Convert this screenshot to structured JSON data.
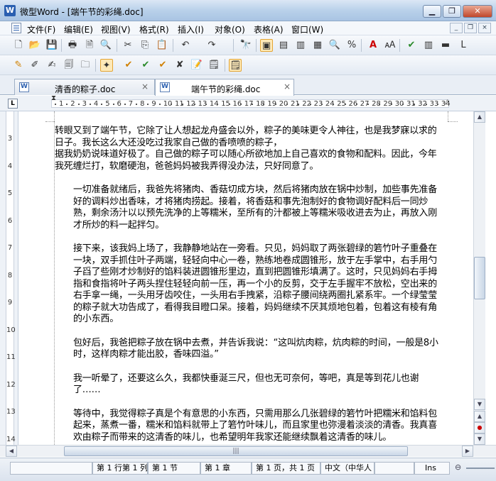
{
  "window": {
    "title": "微型Word - [端午节的彩绳.doc]",
    "app_icon": "W"
  },
  "window_controls": {
    "minimize": "▁",
    "restore": "❐",
    "close": "✕"
  },
  "menubar": {
    "items": [
      "文件(F)",
      "编辑(E)",
      "视图(V)",
      "格式(R)",
      "插入(I)",
      "对象(O)",
      "表格(A)",
      "窗口(W)"
    ],
    "mdi": {
      "minimize": "_",
      "restore": "❐",
      "close": "×"
    }
  },
  "toolbar1": {
    "icons": [
      "new-doc",
      "open-folder",
      "save",
      "print",
      "pdf",
      "print-preview",
      "cut",
      "copy",
      "paste",
      "undo",
      "redo",
      "find",
      "page-layout",
      "web-layout",
      "outline",
      "normal-view",
      "zoom",
      "find-replace",
      "font",
      "text-format",
      "spell-check",
      "columns",
      "format-painter",
      "justify"
    ],
    "glyphs": [
      "🗋",
      "📂",
      "💾",
      "🖶",
      "🗎",
      "🔍",
      "✂",
      "⎘",
      "📋",
      "↶",
      "↷",
      "🔭",
      "▣",
      "▤",
      "▥",
      "▦",
      "🔍",
      "%",
      "A",
      "🗚",
      "✔",
      "▥",
      "▬",
      "L"
    ]
  },
  "toolbar2": {
    "icons": [
      "track-changes",
      "edit-comment",
      "insert-comment",
      "delete-comment",
      "review-pane",
      "show-markup",
      "accept-change",
      "reject-change",
      "next-change",
      "prev-change",
      "sign-document",
      "final-document"
    ],
    "glyphs": [
      "✎",
      "✐",
      "✍",
      "🗐",
      "🗀",
      "✦",
      "✔",
      "✔",
      "✔",
      "✘",
      "📝",
      "🗒"
    ]
  },
  "tabs": [
    {
      "label": "清香的粽子.doc",
      "close": "×",
      "active": false
    },
    {
      "label": "端午节的彩绳.doc",
      "close": "×",
      "active": true
    }
  ],
  "ruler": {
    "corner": "L",
    "numbers": [
      "1",
      "2",
      "3",
      "4",
      "5",
      "6",
      "7",
      "8",
      "9",
      "10",
      "11",
      "12",
      "13",
      "14",
      "15",
      "16",
      "17",
      "18",
      "19",
      "20",
      "21",
      "22",
      "23",
      "24",
      "25",
      "26",
      "27",
      "28",
      "29",
      "30",
      "31",
      "32",
      "33",
      "34"
    ]
  },
  "vruler": {
    "numbers": [
      "3",
      "4",
      "5",
      "6",
      "7",
      "8",
      "9",
      "10",
      "11",
      "12",
      "13",
      "14"
    ]
  },
  "document": {
    "paragraphs": [
      {
        "indent": false,
        "text": "转眼又到了端午节，它除了让人想起龙舟盛会以外，粽子的美味更令人神往，也是我梦寐以求的日子。我长这么大还没吃过我家自己做的香喷喷的粽子，"
      },
      {
        "indent": false,
        "text": "据我奶奶说味道好极了。自己做的粽子可以随心所欲地加上自己喜欢的食物和配料。因此，今年我死缠烂打，软磨硬泡，爸爸妈妈被我弄得没办法，只好同意了。"
      },
      {
        "indent": true,
        "text": "一切准备就绪后，我爸先将猪肉、香菇切成方块，然后将猪肉放在锅中炒制，加些事先准备好的调料炒出香味，才将猪肉捞起。接着，将香菇和事先泡制好的食物调好配料后一同炒熟，剩余汤汁以以预先洗净的上等糯米，至所有的汁都被上等糯米吸收进去为止，再放入刚才所炒的料一起拌匀。"
      },
      {
        "indent": true,
        "text": "接下来，该我妈上场了，我静静地站在一旁看。只见，妈妈取了两张碧绿的箬竹叶子重叠在一块，双手抓住叶子两端，轻轻向中心一卷，熟练地卷成圆锥形，放于左手掌中，右手用勺子舀了些刚才炒制好的馅料装进圆锥形里边，直到把圆锥形填满了。这时，只见妈妈右手拇指和食指将叶子两头捏住轻轻向前一压，再一个小的反剪，交于左手握牢不放松，空出来的右手拿一绳，一头用牙齿咬住，一头用右手拽紧，沿粽子腰间绕两圈扎紧系牢。一个绿莹莹的粽子就大功告成了，看得我目瞪口呆。接着，妈妈继续不厌其烦地包着，包着这有棱有角的小东西。"
      },
      {
        "indent": true,
        "text": "包好后，我爸把粽子放在锅中去煮，并告诉我说：“这叫炕肉粽，炕肉粽的时间，一般是8小时，这样肉粽才能出胶，香味四溢。”"
      },
      {
        "indent": true,
        "text": "我一听晕了，还要这么久，我都快垂涎三尺，但也无可奈何，等吧，真是等到花儿也谢了……"
      },
      {
        "indent": true,
        "text": "等待中，我觉得粽子真是个有意思的小东西，只需用那么几张碧绿的箬竹叶把糯米和馅料包起来，蒸煮一番，糯米和馅料就带上了箬竹叶味儿，而且家里也弥漫着淡淡的清香。我真喜欢由粽子而带来的这清香的味儿，也希望明年我家还能继续飘着这清香的味儿。"
      }
    ]
  },
  "scroll": {
    "up": "▲",
    "down": "▼",
    "left": "◀",
    "right": "▶",
    "prev_page": "▲",
    "browse_object": "●",
    "next_page": "▼",
    "grip": "|||"
  },
  "status": {
    "position": "第 1 行第 1 列",
    "section": "第 1 节",
    "chapter": "第 1 章",
    "page": "第 1 页，共 1 页",
    "language": "中文（中华人",
    "mode": "Ins",
    "zoom_minus": "⊖"
  }
}
